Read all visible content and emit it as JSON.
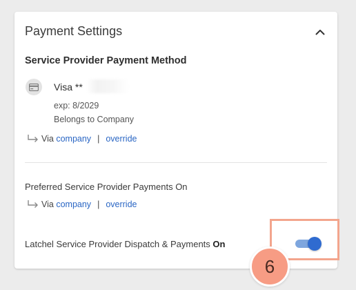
{
  "panel": {
    "title": "Payment Settings",
    "collapse_icon": "chevron-up-icon"
  },
  "payment_method": {
    "heading": "Service Provider Payment Method",
    "card_icon": "credit-card-icon",
    "card_brand": "Visa **",
    "expiry": "exp: 8/2029",
    "belongs_to": "Belongs to Company",
    "via": {
      "prefix": "Via",
      "company_link": "company",
      "separator": "|",
      "override_link": "override"
    }
  },
  "preferred_payments": {
    "label": "Preferred Service Provider Payments On",
    "via": {
      "prefix": "Via",
      "company_link": "company",
      "separator": "|",
      "override_link": "override"
    }
  },
  "latchel_dispatch": {
    "label": "Latchel Service Provider Dispatch & Payments",
    "state_text": "On",
    "toggle_on": true
  },
  "annotation": {
    "step_number": "6",
    "highlight_color": "#f3a58d",
    "badge_color": "#f79c84"
  },
  "colors": {
    "link": "#2a66c4",
    "toggle_knob": "#2f6bd0",
    "toggle_track": "#7ea6de"
  }
}
